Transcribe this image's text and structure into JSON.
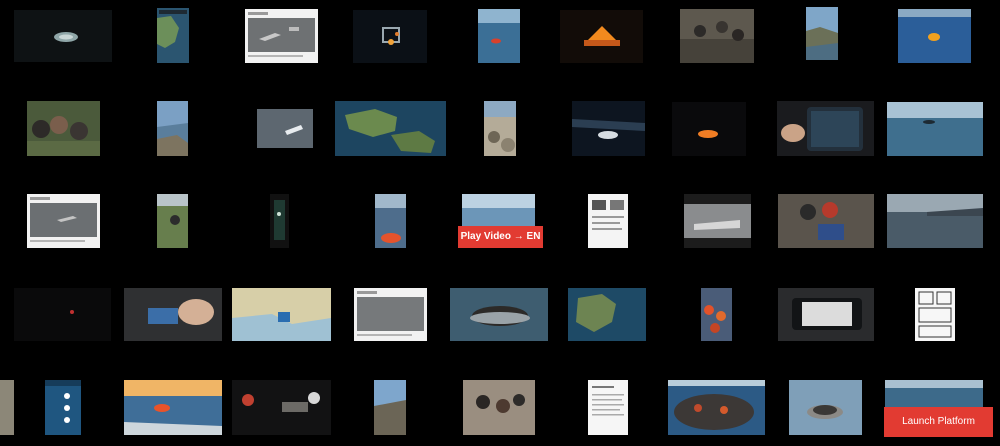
{
  "buttons": {
    "play_video": "Play Video → EN",
    "launch_platform": "Launch Platform"
  },
  "colors": {
    "background": "#000000",
    "accent": "#e23b32"
  }
}
